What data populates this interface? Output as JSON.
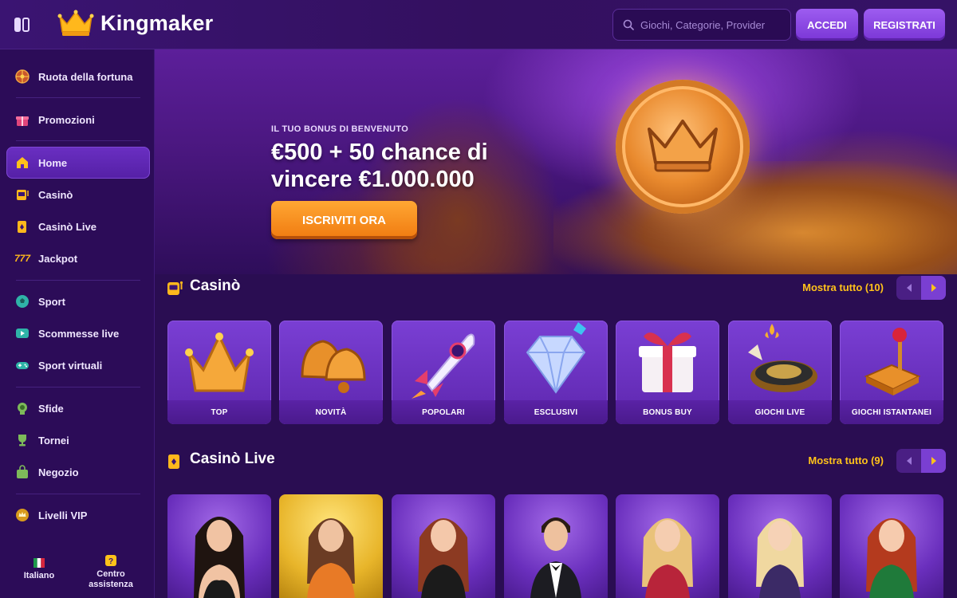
{
  "header": {
    "brand": "Kingmaker",
    "search_placeholder": "Giochi, Categorie, Provider",
    "login_label": "ACCEDI",
    "register_label": "REGISTRATI"
  },
  "sidebar": {
    "items": [
      {
        "label": "Ruota della fortuna",
        "icon": "wheel-icon"
      },
      {
        "label": "Promozioni",
        "icon": "gift-icon"
      },
      {
        "label": "Home",
        "icon": "home-icon",
        "active": true
      },
      {
        "label": "Casinò",
        "icon": "slot-machine-icon"
      },
      {
        "label": "Casinò Live",
        "icon": "cards-icon"
      },
      {
        "label": "Jackpot",
        "icon": "jackpot-777-icon"
      },
      {
        "label": "Sport",
        "icon": "soccer-ball-icon"
      },
      {
        "label": "Scommesse live",
        "icon": "live-play-icon"
      },
      {
        "label": "Sport virtuali",
        "icon": "gamepad-icon"
      },
      {
        "label": "Sfide",
        "icon": "medal-icon"
      },
      {
        "label": "Tornei",
        "icon": "trophy-icon"
      },
      {
        "label": "Negozio",
        "icon": "shop-bag-icon"
      },
      {
        "label": "Livelli VIP",
        "icon": "vip-crown-icon"
      }
    ],
    "footer": {
      "language": "Italiano",
      "help_line1": "Centro",
      "help_line2": "assistenza"
    }
  },
  "banner": {
    "subtitle": "IL TUO BONUS DI BENVENUTO",
    "title": "€500 + 50 chance di vincere €1.000.000",
    "cta": "ISCRIVITI ORA"
  },
  "casino": {
    "title": "Casinò",
    "show_all": "Mostra tutto (10)",
    "categories": [
      {
        "label": "TOP"
      },
      {
        "label": "NOVITÀ"
      },
      {
        "label": "POPOLARI"
      },
      {
        "label": "ESCLUSIVI"
      },
      {
        "label": "BONUS BUY"
      },
      {
        "label": "GIOCHI LIVE"
      },
      {
        "label": "GIOCHI ISTANTANEI"
      }
    ]
  },
  "casino_live": {
    "title": "Casinò Live",
    "show_all": "Mostra tutto (9)"
  },
  "colors": {
    "accent_gold": "#ffc21a",
    "primary_purple": "#7a36d6",
    "cta_orange": "#f07a10",
    "background": "#2a0d52"
  }
}
